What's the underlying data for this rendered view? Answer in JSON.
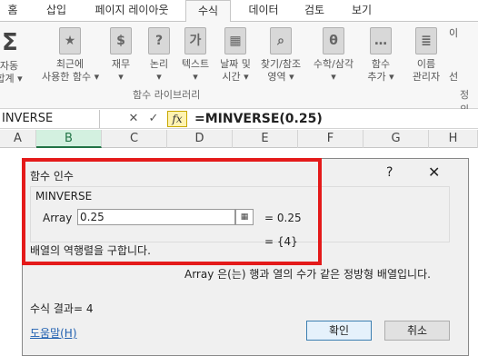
{
  "ribbon_tabs": [
    "홈",
    "삽입",
    "페이지 레이아웃",
    "수식",
    "데이터",
    "검토",
    "보기"
  ],
  "ribbon_buttons": [
    {
      "label": "자동\n합계 ▾",
      "icon": "sigma-icon"
    },
    {
      "label": "최근에\n사용한 함수 ▾",
      "icon": "star-book-icon"
    },
    {
      "label": "재무\n▾",
      "icon": "finance-book-icon"
    },
    {
      "label": "논리\n▾",
      "icon": "logic-book-icon"
    },
    {
      "label": "텍스트\n▾",
      "icon": "text-book-icon"
    },
    {
      "label": "날짜 및\n시간 ▾",
      "icon": "calendar-book-icon"
    },
    {
      "label": "찾기/참조\n영역 ▾",
      "icon": "lookup-book-icon"
    },
    {
      "label": "수학/삼각\n▾",
      "icon": "math-book-icon"
    },
    {
      "label": "함수\n추가 ▾",
      "icon": "more-functions-icon"
    },
    {
      "label": "이름\n관리자",
      "icon": "name-manager-icon"
    }
  ],
  "ribbon_group_label": "함수 라이브러리",
  "ribbon_right_labels": [
    "이",
    "선"
  ],
  "ribbon_right_group": "정의",
  "formula_bar": {
    "name_box": "INVERSE",
    "cancel_symbol": "✕",
    "enter_symbol": "✓",
    "fx_label": "fx",
    "formula": "=MINVERSE(0.25)"
  },
  "columns": [
    "A",
    "B",
    "C",
    "D",
    "E",
    "F",
    "G",
    "H"
  ],
  "active_column": "B",
  "dialog": {
    "title": "함수 인수",
    "help_symbol": "?",
    "close_symbol": "✕",
    "function_name": "MINVERSE",
    "arg_label": "Array",
    "arg_value": "0.25",
    "arg_equals": "= 0.25",
    "result_equals": "= {4}",
    "description": "배열의 역행렬을 구합니다.",
    "arg_description": "Array  은(는) 행과 열의 수가 같은 정방형 배열입니다.",
    "result_label": "수식 결과= 4",
    "help_link": "도움말(H)",
    "ok_label": "확인",
    "cancel_label": "취소"
  },
  "colors": {
    "highlight_box": "#e41a1a",
    "active_column": "#217346",
    "link": "#2060b0"
  }
}
